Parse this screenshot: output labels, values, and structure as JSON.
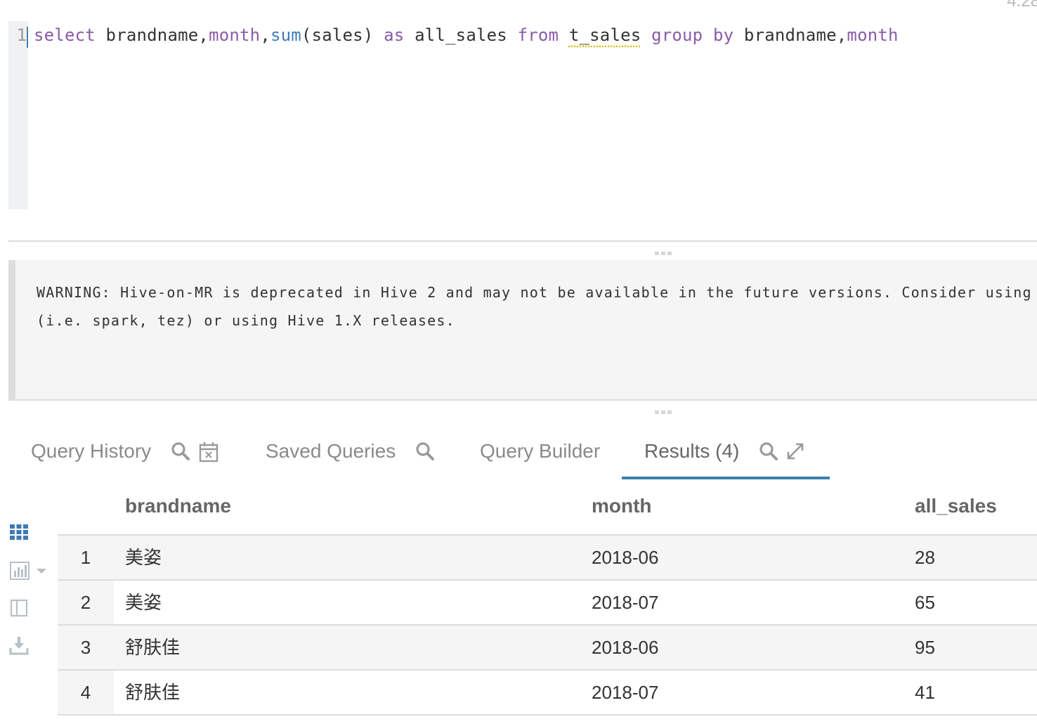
{
  "corner_label": "4.28",
  "editor": {
    "line_number": "1",
    "tokens": {
      "t1": "select",
      "t2": " brandname,",
      "t3": "month",
      "t4": ",",
      "t5": "sum",
      "t6": "(sales) ",
      "t7": "as",
      "t8": " all_sales ",
      "t9": "from",
      "t10": " ",
      "t11": "t_sales",
      "t12": " ",
      "t13": "group by",
      "t14": " brandname,",
      "t15": "month"
    }
  },
  "log": {
    "line1": "WARNING: Hive-on-MR is deprecated in Hive 2 and may not be available in the future versions. Consider using a",
    "line2": "(i.e. spark, tez) or using Hive 1.X releases."
  },
  "tabs": {
    "query_history": "Query History",
    "saved_queries": "Saved Queries",
    "query_builder": "Query Builder",
    "results": "Results (4)"
  },
  "sidebar": {
    "icons": [
      "grid-icon",
      "bar-chart-icon",
      "columns-icon",
      "download-icon"
    ]
  },
  "results": {
    "columns": [
      "brandname",
      "month",
      "all_sales"
    ],
    "rows": [
      {
        "index": "1",
        "brandname": "美姿",
        "month": "2018-06",
        "all_sales": "28"
      },
      {
        "index": "2",
        "brandname": "美姿",
        "month": "2018-07",
        "all_sales": "65"
      },
      {
        "index": "3",
        "brandname": "舒肤佳",
        "month": "2018-06",
        "all_sales": "95"
      },
      {
        "index": "4",
        "brandname": "舒肤佳",
        "month": "2018-07",
        "all_sales": "41"
      }
    ]
  },
  "colors": {
    "keyword": "#8a5ba8",
    "function": "#3d7bb5",
    "active_tab": "#3a7fad",
    "icon_blue": "#3d7bb5",
    "icon_gray": "#b5c0c8"
  }
}
